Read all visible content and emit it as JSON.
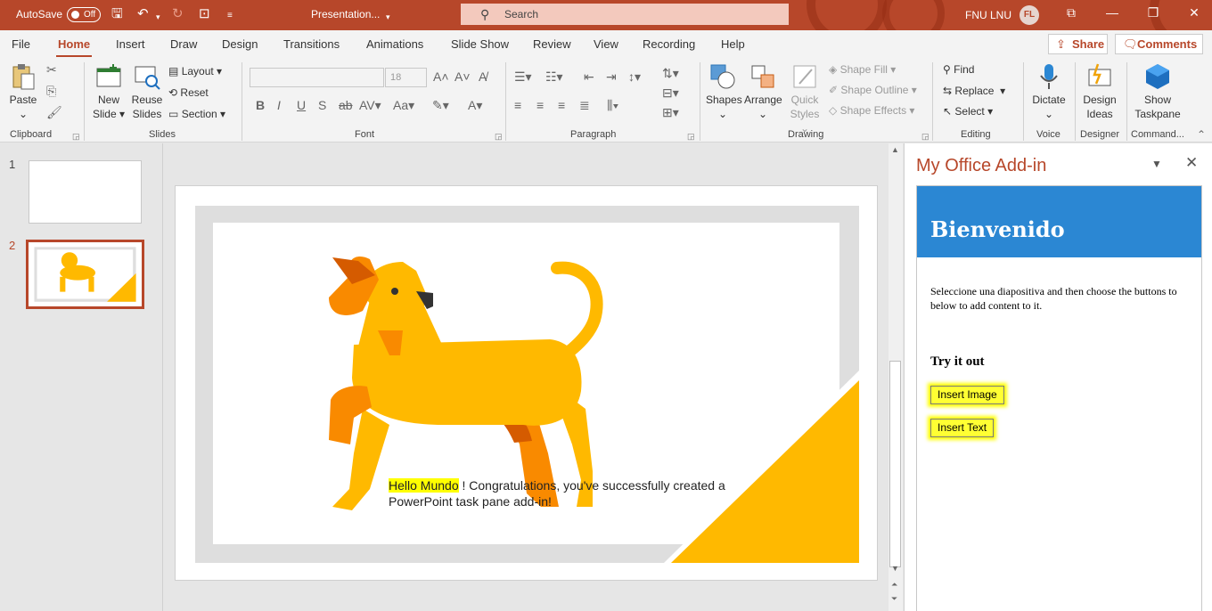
{
  "titlebar": {
    "autosave_label": "AutoSave",
    "autosave_state": "Off",
    "doc_title": "Presentation...",
    "search_placeholder": "Search",
    "user_name": "FNU LNU",
    "user_initials": "FL"
  },
  "menu": {
    "tabs": [
      "File",
      "Home",
      "Insert",
      "Draw",
      "Design",
      "Transitions",
      "Animations",
      "Slide Show",
      "Review",
      "View",
      "Recording",
      "Help"
    ],
    "active_tab": "Home",
    "share_label": "Share",
    "comments_label": "Comments"
  },
  "ribbon": {
    "clipboard": {
      "label": "Clipboard",
      "paste": "Paste"
    },
    "slides": {
      "label": "Slides",
      "new_slide_1": "New",
      "new_slide_2": "Slide",
      "reuse_1": "Reuse",
      "reuse_2": "Slides",
      "layout": "Layout",
      "reset": "Reset",
      "section": "Section"
    },
    "font": {
      "label": "Font",
      "size": "18"
    },
    "paragraph": {
      "label": "Paragraph"
    },
    "drawing": {
      "label": "Drawing",
      "shapes": "Shapes",
      "arrange": "Arrange",
      "quick_1": "Quick",
      "quick_2": "Styles",
      "shape_fill": "Shape Fill",
      "shape_outline": "Shape Outline",
      "shape_effects": "Shape Effects"
    },
    "editing": {
      "label": "Editing",
      "find": "Find",
      "replace": "Replace",
      "select": "Select"
    },
    "voice": {
      "label": "Voice",
      "dictate": "Dictate"
    },
    "designer": {
      "label": "Designer",
      "design_1": "Design",
      "design_2": "Ideas"
    },
    "commands": {
      "label": "Command...",
      "show_1": "Show",
      "show_2": "Taskpane"
    }
  },
  "slides_pane": {
    "slide_numbers": [
      "1",
      "2"
    ],
    "selected": 2
  },
  "slide": {
    "highlight_text": "Hello Mundo",
    "body_text_1": " ! Congratulations, you've successfully created a",
    "body_text_2": "PowerPoint task pane add-in!"
  },
  "task_pane": {
    "title": "My Office Add-in",
    "banner_heading": "Bienvenido",
    "intro": "Seleccione una diapositiva and then choose the buttons to below to add content to it.",
    "try_heading": "Try it out",
    "insert_image_button": "Insert Image",
    "insert_text_button": "Insert Text"
  },
  "colors": {
    "accent": "#b7472a",
    "addin_banner": "#2b87d3",
    "dog_yellow": "#ffb900",
    "dog_orange": "#f98a00",
    "dog_dark": "#d55b00",
    "highlight": "#ffff00"
  }
}
